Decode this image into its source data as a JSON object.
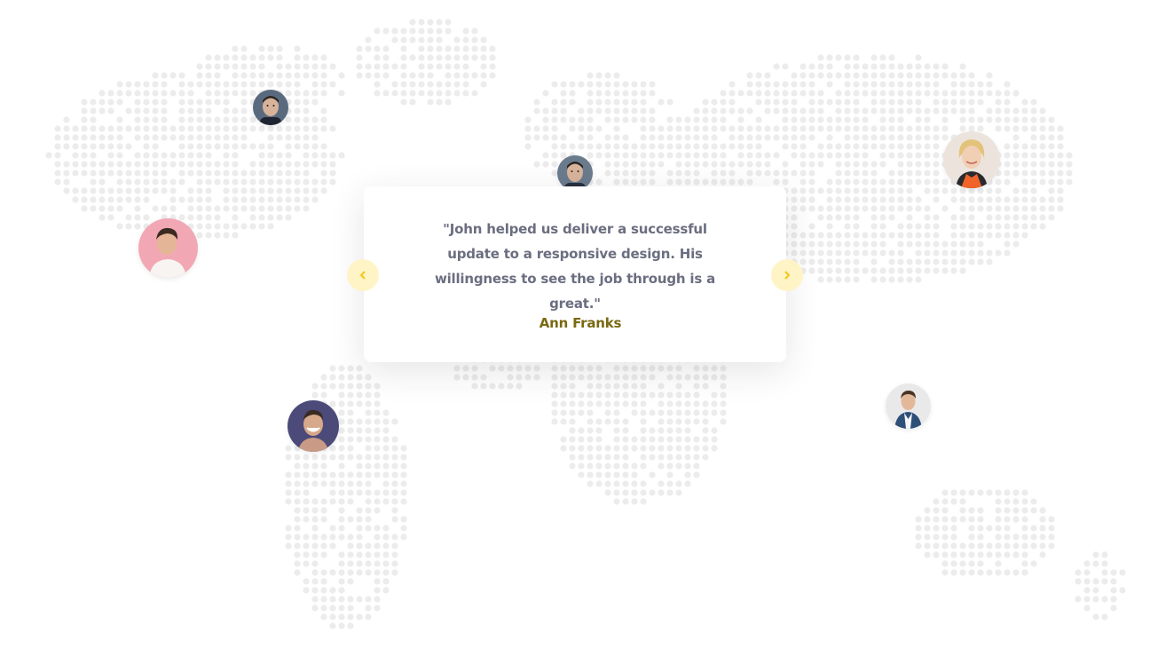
{
  "testimonial": {
    "quote": "\"John helped us deliver a successful update to a responsive design. His willingness to see the job through is a great.\"",
    "author": "Ann Franks"
  },
  "navigation": {
    "prev_icon": "chevron-left-icon",
    "next_icon": "chevron-right-icon",
    "accent_color": "#f5c518",
    "button_bg": "#fff4c6"
  },
  "avatars": [
    {
      "name": "avatar-north-america-man"
    },
    {
      "name": "avatar-active-testimonial"
    },
    {
      "name": "avatar-europe-woman"
    },
    {
      "name": "avatar-pink-background-man"
    },
    {
      "name": "avatar-south-america-smiling-man"
    },
    {
      "name": "avatar-asia-suit-man"
    }
  ],
  "colors": {
    "quote_text": "#6b6e80",
    "author_text": "#7a6a12",
    "map_dots": "#ececec"
  }
}
